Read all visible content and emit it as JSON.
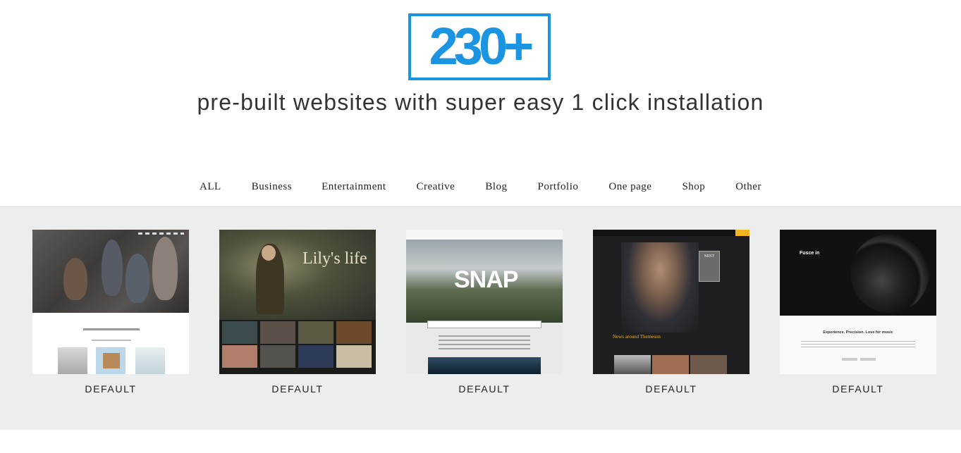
{
  "hero": {
    "count": "230+",
    "subtitle": "pre-built websites with super easy 1 click installation",
    "accent_color": "#1b94e2"
  },
  "filters": [
    {
      "label": "ALL"
    },
    {
      "label": "Business"
    },
    {
      "label": "Entertainment"
    },
    {
      "label": "Creative"
    },
    {
      "label": "Blog"
    },
    {
      "label": "Portfolio"
    },
    {
      "label": "One page"
    },
    {
      "label": "Shop"
    },
    {
      "label": "Other"
    }
  ],
  "gallery": {
    "background": "#eceeed",
    "cards": [
      {
        "label": "DEFAULT"
      },
      {
        "label": "DEFAULT",
        "thumb_title": "Lily's life"
      },
      {
        "label": "DEFAULT",
        "thumb_title": "SNAP"
      },
      {
        "label": "DEFAULT",
        "thumb_title": "News around Themeson",
        "thumb_book": "MIST"
      },
      {
        "label": "DEFAULT",
        "thumb_title": "Fusce in",
        "thumb_tagline": "Experience. Precision. Love for music"
      }
    ]
  }
}
